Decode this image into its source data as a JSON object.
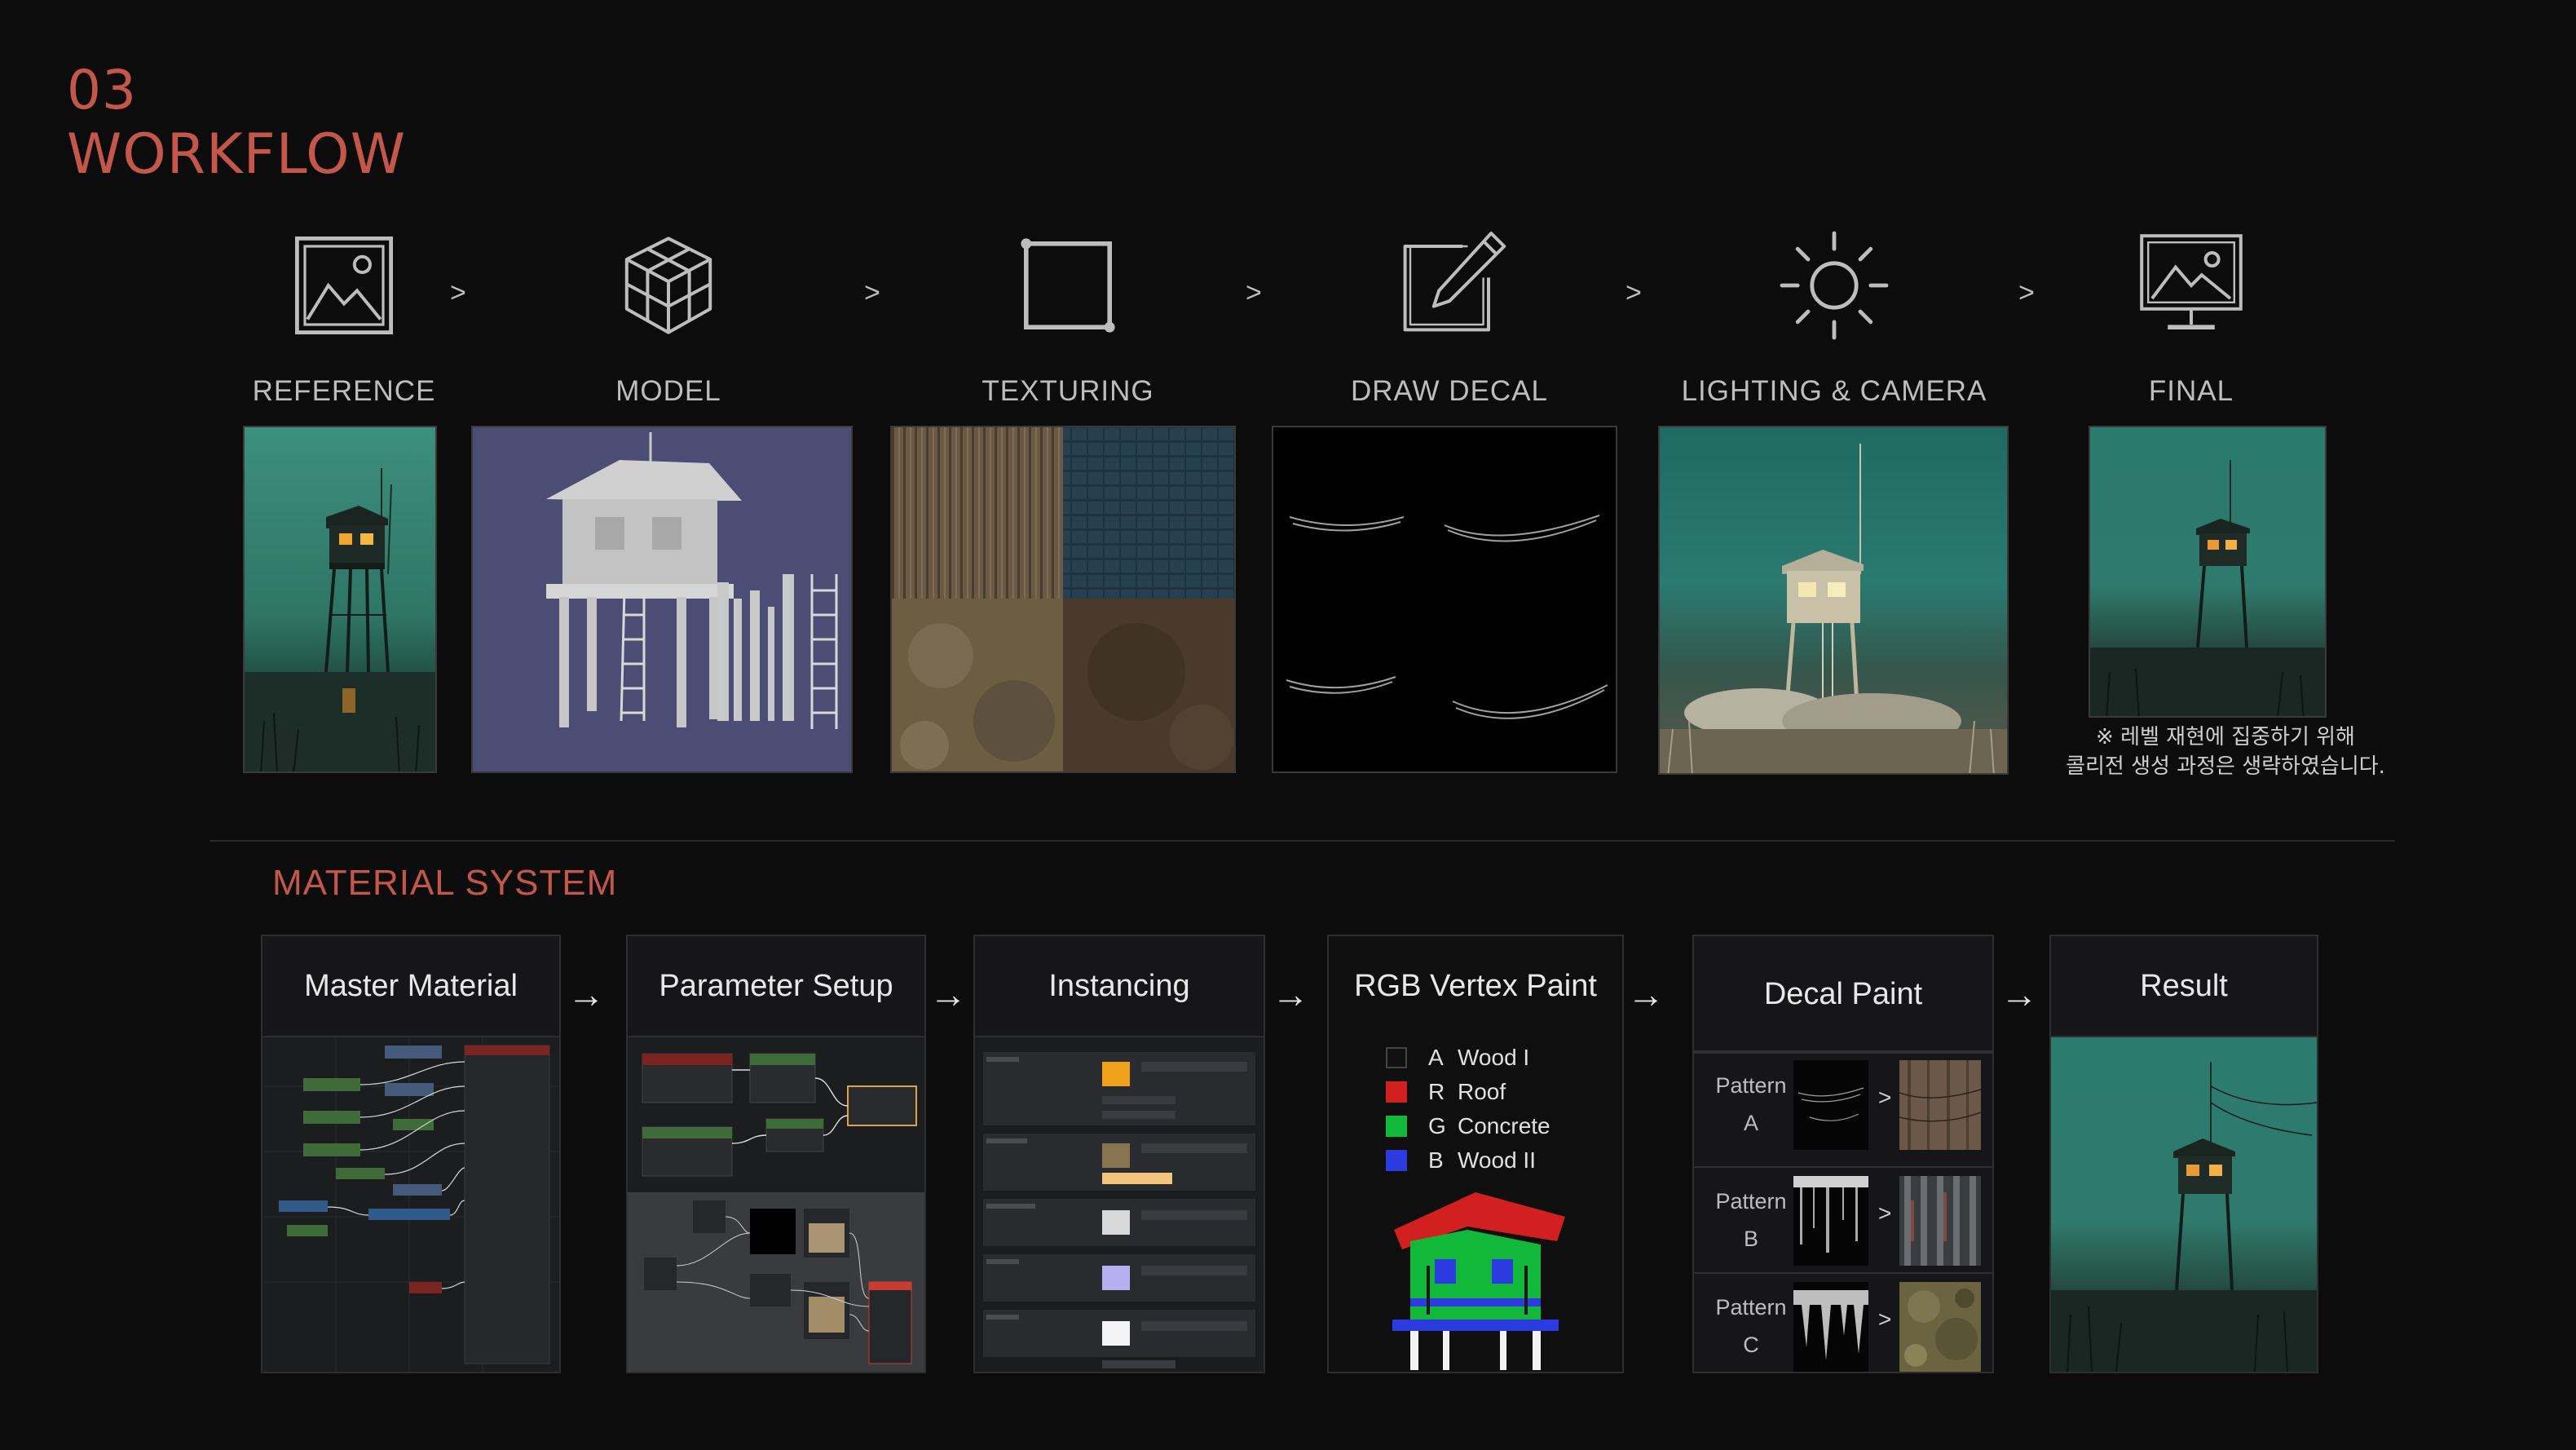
{
  "section": {
    "number": "03",
    "title": "WORKFLOW"
  },
  "workflow": {
    "separator": ">",
    "steps": [
      {
        "label": "REFERENCE",
        "icon": "image-icon"
      },
      {
        "label": "MODEL",
        "icon": "cube-icon"
      },
      {
        "label": "TEXTURING",
        "icon": "square-frame-icon"
      },
      {
        "label": "DRAW DECAL",
        "icon": "pencil-edit-icon"
      },
      {
        "label": "LIGHTING & CAMERA",
        "icon": "sun-icon"
      },
      {
        "label": "FINAL",
        "icon": "monitor-image-icon"
      }
    ],
    "note": [
      "※ 레벨 재현에 집중하기 위해",
      "콜리전 생성 과정은 생략하였습니다."
    ]
  },
  "material_system": {
    "title": "MATERIAL SYSTEM",
    "arrow": "→",
    "panels": [
      {
        "title": "Master Material"
      },
      {
        "title": "Parameter Setup"
      },
      {
        "title": "Instancing"
      },
      {
        "title": "RGB Vertex Paint"
      },
      {
        "title": "Decal Paint"
      },
      {
        "title": "Result"
      }
    ],
    "vertex_paint": [
      {
        "channel": "A",
        "name": "Wood I",
        "color": "#111111"
      },
      {
        "channel": "R",
        "name": "Roof",
        "color": "#d21f1f"
      },
      {
        "channel": "G",
        "name": "Concrete",
        "color": "#12b83a"
      },
      {
        "channel": "B",
        "name": "Wood II",
        "color": "#2c3be0"
      }
    ],
    "decal_patterns": [
      {
        "word": "Pattern",
        "letter": "A"
      },
      {
        "word": "Pattern",
        "letter": "B"
      },
      {
        "word": "Pattern",
        "letter": "C"
      }
    ]
  },
  "colors": {
    "accent": "#c4574a",
    "background": "#0c0c0d"
  }
}
